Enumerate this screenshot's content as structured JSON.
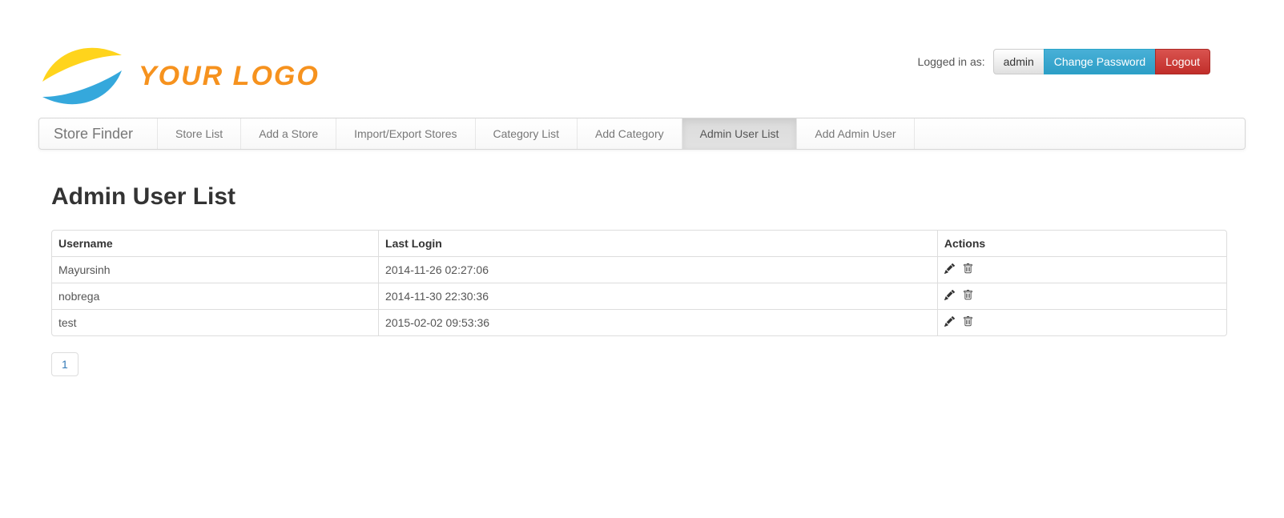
{
  "header": {
    "logo_text": "YOUR LOGO",
    "logged_in_label": "Logged in as:",
    "username_button": "admin",
    "change_password_button": "Change Password",
    "logout_button": "Logout"
  },
  "navbar": {
    "brand": "Store Finder",
    "items": [
      {
        "label": "Store List",
        "active": false
      },
      {
        "label": "Add a Store",
        "active": false
      },
      {
        "label": "Import/Export Stores",
        "active": false
      },
      {
        "label": "Category List",
        "active": false
      },
      {
        "label": "Add Category",
        "active": false
      },
      {
        "label": "Admin User List",
        "active": true
      },
      {
        "label": "Add Admin User",
        "active": false
      }
    ]
  },
  "main": {
    "title": "Admin User List",
    "table": {
      "columns": [
        "Username",
        "Last Login",
        "Actions"
      ],
      "rows": [
        {
          "username": "Mayursinh",
          "last_login": "2014-11-26 02:27:06"
        },
        {
          "username": "nobrega",
          "last_login": "2014-11-30 22:30:36"
        },
        {
          "username": "test",
          "last_login": "2015-02-02 09:53:36"
        }
      ],
      "row_action_icons": [
        "pencil-icon",
        "trash-icon"
      ]
    },
    "pagination": {
      "pages": [
        "1"
      ]
    }
  },
  "icons": {
    "logo": "double-wave-icon",
    "edit": "pencil-icon",
    "delete": "trash-icon"
  },
  "colors": {
    "logo_yellow": "#ffd41c",
    "logo_blue": "#35a8dc",
    "logo_orange": "#f6921e",
    "info_top": "#48b0d7",
    "info_bottom": "#2d9ec6",
    "danger_top": "#d9534f",
    "danger_bottom": "#c12e2a",
    "link_blue": "#337ab7"
  }
}
